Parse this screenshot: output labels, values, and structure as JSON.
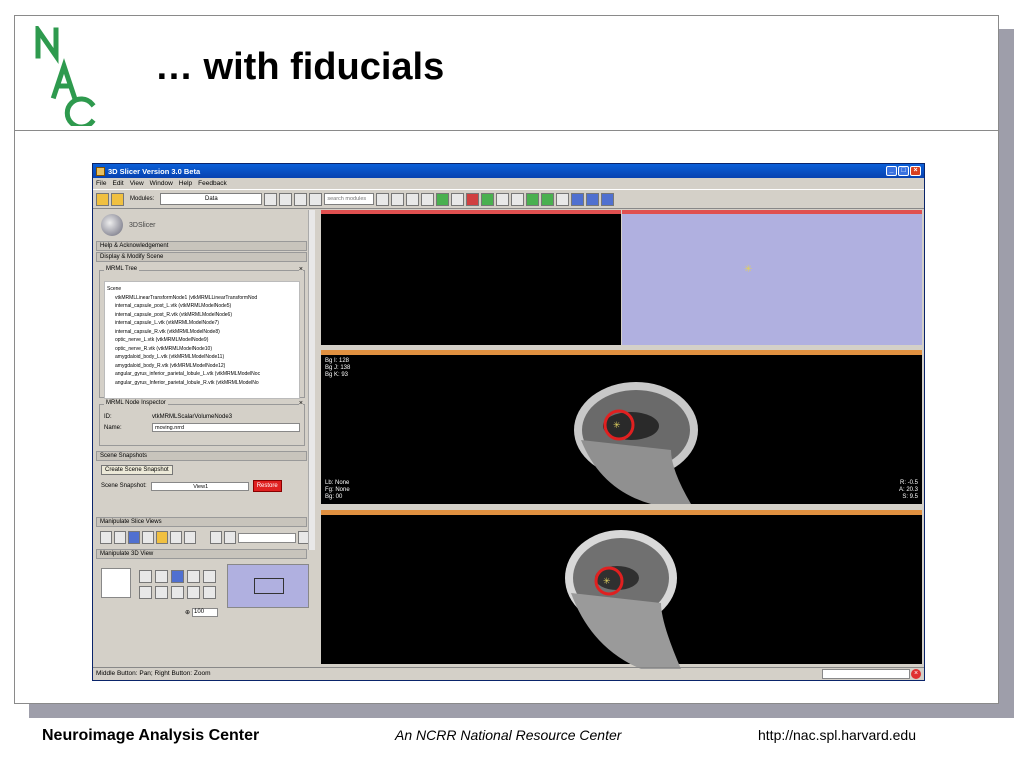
{
  "slide": {
    "title": "… with fiducials",
    "footer_left": "Neuroimage Analysis Center",
    "footer_center": "An NCRR National Resource Center",
    "footer_right": "http://nac.spl.harvard.edu",
    "accent_color": "#2e9a4e"
  },
  "app": {
    "title": "3D Slicer Version 3.0 Beta",
    "menu": [
      "File",
      "Edit",
      "View",
      "Window",
      "Help",
      "Feedback"
    ],
    "modules_label": "Modules:",
    "module_value": "Data",
    "search_placeholder": "search modules",
    "logo_text": "3DSlicer",
    "sections": {
      "help": "Help & Acknowledgement",
      "display": "Display & Modify Scene",
      "snapshots": "Scene Snapshots",
      "slice_views": "Manipulate Slice Views",
      "view3d": "Manipulate 3D View"
    },
    "mrml_tree": {
      "legend": "MRML Tree",
      "items": [
        "Scene",
        "vtkMRMLLinearTransformNode1 (vtkMRMLLinearTransformNod",
        "internal_capsule_post_L.vtk (vtkMRMLModelNode5)",
        "internal_capsule_post_R.vtk (vtkMRMLModelNode6)",
        "internal_capsule_L.vtk (vtkMRMLModelNode7)",
        "internal_capsule_R.vtk (vtkMRMLModelNode8)",
        "optic_nerve_L.vtk (vtkMRMLModelNode9)",
        "optic_nerve_R.vtk (vtkMRMLModelNode10)",
        "amygdaloid_body_L.vtk (vtkMRMLModelNode11)",
        "amygdaloid_body_R.vtk (vtkMRMLModelNode12)",
        "angular_gyrus_inferior_parietal_lobule_L.vtk (vtkMRMLModelNoc",
        "angular_gyrus_Inferior_parietal_lobule_R.vtk (vtkMRMLModelNo"
      ]
    },
    "inspector": {
      "legend": "MRML Node Inspector",
      "id_label": "ID:",
      "id_value": "vtkMRMLScalarVolumeNode3",
      "name_label": "Name:",
      "name_value": "moving.nrrd"
    },
    "snapshot": {
      "create_button": "Create Scene Snapshot",
      "label": "Scene Snapshot:",
      "value": "View1",
      "restore_button": "Restore"
    },
    "zoom_value": "100",
    "slice1_overlay": {
      "bg_i": "Bg I: 128",
      "bg_j": "Bg J: 138",
      "bg_k": "Bg K: 93",
      "lb": "Lb: None",
      "fg": "Fg: None",
      "bg": "Bg: 00",
      "r": "R: -0.5",
      "a": "A: 20.3",
      "s": "S: 9.5"
    },
    "status_text": "Middle Button: Pan; Right Button: Zoom"
  }
}
